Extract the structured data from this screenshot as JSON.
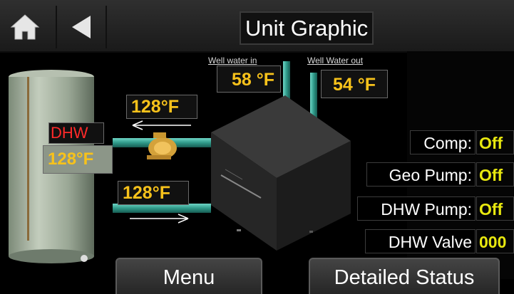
{
  "header": {
    "title": "Unit Graphic",
    "home_icon": "home-icon",
    "back_icon": "back-arrow-icon"
  },
  "tank": {
    "label": "DHW",
    "temperature": "128",
    "unit": "°F",
    "label_color": "#ff2a2a",
    "temp_color": "#f7c21b"
  },
  "pipes": {
    "supply_temp": "128",
    "return_temp": "128",
    "unit": "°F",
    "pump_icon": "pump-icon"
  },
  "well": {
    "in_label": "Well water in",
    "in_temp": "58",
    "out_label": "Well Water out",
    "out_temp": "54",
    "unit": "°F"
  },
  "status": [
    {
      "label": "Comp:",
      "value": "Off"
    },
    {
      "label": "Geo Pump:",
      "value": "Off"
    },
    {
      "label": "DHW Pump:",
      "value": "Off"
    },
    {
      "label": "DHW Valve",
      "value": "000"
    }
  ],
  "buttons": {
    "menu": "Menu",
    "detailed_status": "Detailed Status"
  },
  "colors": {
    "value_yellow": "#e8e80f",
    "temp_orange": "#f7c21b",
    "pipe_teal": "#2f9a8a"
  }
}
